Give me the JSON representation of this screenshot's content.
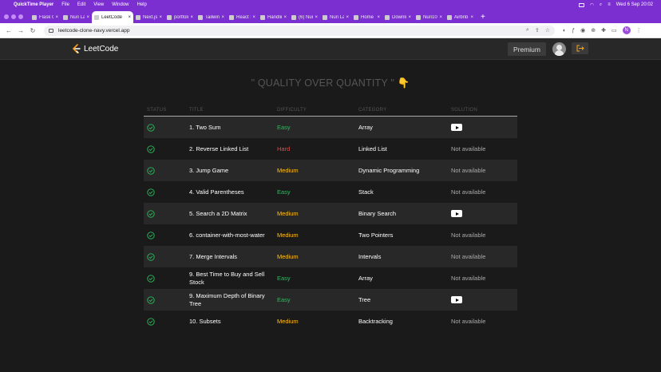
{
  "menubar": {
    "app": "QuickTime Player",
    "items": [
      "File",
      "Edit",
      "View",
      "Window",
      "Help"
    ],
    "clock": "Wed 6 Sep  20:02"
  },
  "tabs": [
    {
      "label": "Flask Opt",
      "active": false
    },
    {
      "label": "Nuri Laca",
      "active": false
    },
    {
      "label": "LeetCode",
      "active": true
    },
    {
      "label": "Next.js b",
      "active": false
    },
    {
      "label": "portfolio",
      "active": false
    },
    {
      "label": "Tailwind C",
      "active": false
    },
    {
      "label": "React Ico",
      "active": false
    },
    {
      "label": "Handling",
      "active": false
    },
    {
      "label": "(6) Nuri L",
      "active": false
    },
    {
      "label": "Nuri Laca",
      "active": false
    },
    {
      "label": "Home | S",
      "active": false
    },
    {
      "label": "Downloa",
      "active": false
    },
    {
      "label": "Nuri1077",
      "active": false
    },
    {
      "label": "Airbnb",
      "active": false
    }
  ],
  "address": {
    "url": "leetcode-clone-navy.vercel.app",
    "profile_initial": "N"
  },
  "nav": {
    "logo_text": "LeetCode",
    "premium_label": "Premium"
  },
  "page": {
    "heading": "\" QUALITY OVER QUANTITY \"",
    "heading_emoji": "👇"
  },
  "table": {
    "headers": {
      "status": "STATUS",
      "title": "TITLE",
      "difficulty": "DIFFICULTY",
      "category": "CATEGORY",
      "solution": "SOLUTION"
    },
    "rows": [
      {
        "title": "1. Two Sum",
        "difficulty": "Easy",
        "category": "Array",
        "solution": "video",
        "solution_text": ""
      },
      {
        "title": "2. Reverse Linked List",
        "difficulty": "Hard",
        "category": "Linked List",
        "solution": "none",
        "solution_text": "Not available"
      },
      {
        "title": "3. Jump Game",
        "difficulty": "Medium",
        "category": "Dynamic Programming",
        "solution": "none",
        "solution_text": "Not available"
      },
      {
        "title": "4. Valid Parentheses",
        "difficulty": "Easy",
        "category": "Stack",
        "solution": "none",
        "solution_text": "Not available"
      },
      {
        "title": "5. Search a 2D Matrix",
        "difficulty": "Medium",
        "category": "Binary Search",
        "solution": "video",
        "solution_text": ""
      },
      {
        "title": "6. container-with-most-water",
        "difficulty": "Medium",
        "category": "Two Pointers",
        "solution": "none",
        "solution_text": "Not available"
      },
      {
        "title": "7. Merge Intervals",
        "difficulty": "Medium",
        "category": "Intervals",
        "solution": "none",
        "solution_text": "Not available"
      },
      {
        "title": "9. Best Time to Buy and Sell Stock",
        "difficulty": "Easy",
        "category": "Array",
        "solution": "none",
        "solution_text": "Not available"
      },
      {
        "title": "9. Maximum Depth of Binary Tree",
        "difficulty": "Easy",
        "category": "Tree",
        "solution": "video",
        "solution_text": ""
      },
      {
        "title": "10. Subsets",
        "difficulty": "Medium",
        "category": "Backtracking",
        "solution": "none",
        "solution_text": "Not available"
      }
    ]
  },
  "colors": {
    "easy": "#2cbb5d",
    "medium": "#ffc01e",
    "hard": "#ef4743",
    "check": "#2cbb5d",
    "menubar": "#7b2fd0"
  }
}
